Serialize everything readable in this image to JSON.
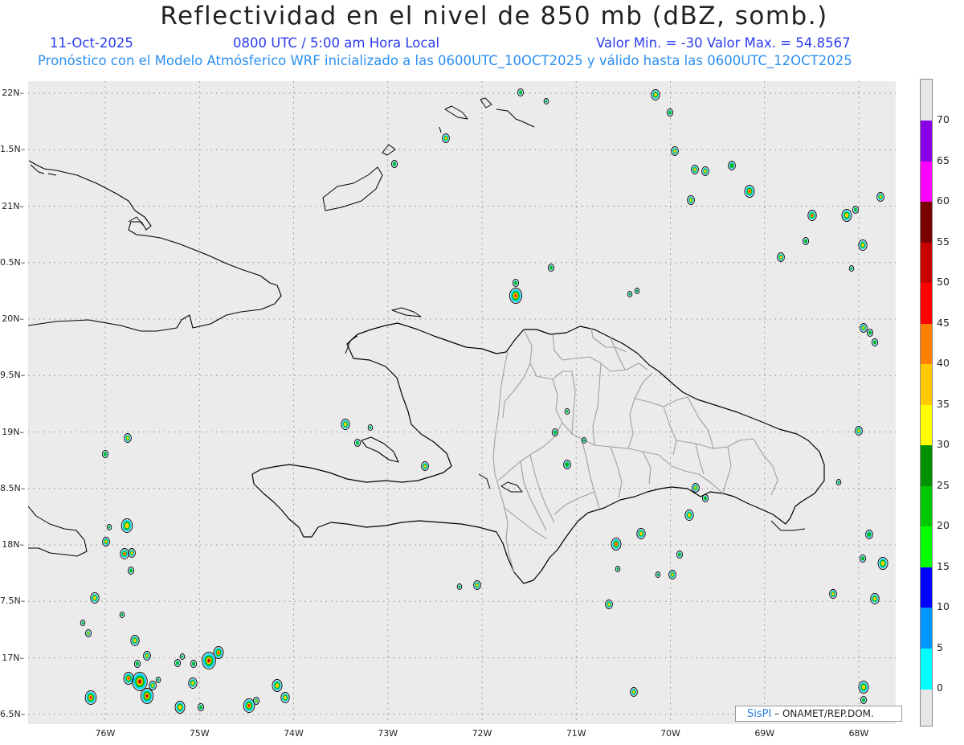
{
  "header": {
    "title": "Reflectividad en el nivel de 850 mb (dBZ, somb.)",
    "date": "11-Oct-2025",
    "time": "0800 UTC / 5:00 am Hora Local",
    "minmax": "Valor Min. = -30  Valor Max. = 54.8567",
    "model_info": "Pronóstico con el Modelo Atmósferico WRF inicializado a las 0600UTC_10OCT2025 y válido hasta las  0600UTC_12OCT2025"
  },
  "axes": {
    "lat_labels": [
      "22N",
      "1.5N",
      "21N",
      "0.5N",
      "20N",
      "9.5N",
      "19N",
      "8.5N",
      "18N",
      "7.5N",
      "17N",
      "6.5N"
    ],
    "lon_labels": [
      "76W",
      "75W",
      "74W",
      "73W",
      "72W",
      "71W",
      "70W",
      "69W",
      "68W"
    ],
    "lat_values": [
      22,
      21.5,
      21,
      20.5,
      20,
      19.5,
      19,
      18.5,
      18,
      17.5,
      17,
      16.5
    ],
    "lon_values": [
      -76,
      -75,
      -74,
      -73,
      -72,
      -71,
      -70,
      -69,
      -68
    ]
  },
  "colorbar": {
    "labels": [
      "70",
      "65",
      "60",
      "55",
      "50",
      "45",
      "40",
      "35",
      "30",
      "25",
      "20",
      "15",
      "10",
      "5",
      "0"
    ],
    "colors": [
      "#8a00e6",
      "#ff00ff",
      "#7a0000",
      "#c80000",
      "#ff0000",
      "#ff7f00",
      "#ffc800",
      "#ffff00",
      "#009100",
      "#00c800",
      "#00ff00",
      "#0000ff",
      "#0096ff",
      "#00ffff"
    ]
  },
  "credit": {
    "brand": "SisPI",
    "text": "– ONAMET/REP.DOM."
  },
  "map": {
    "background": "#ebebeb",
    "coastline_color": "#000000",
    "province_color": "#a0a0a0",
    "grid_color": "#8c8c8c"
  }
}
